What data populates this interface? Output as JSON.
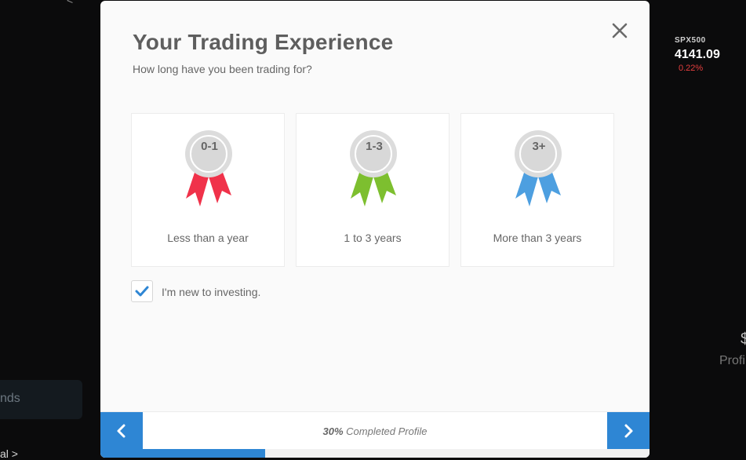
{
  "background": {
    "ticker": {
      "symbol": "SPX500",
      "price": "4141.09",
      "change": "0.22%"
    },
    "right_number": "$",
    "right_label": "Profi",
    "left_button": "nds",
    "left_link": "al >",
    "top_arrow": "<"
  },
  "modal": {
    "title": "Your Trading Experience",
    "subtitle": "How long have you been trading for?",
    "close_icon": "close-icon",
    "options": [
      {
        "badge": "0-1",
        "label": "Less than a year",
        "ribbon_color": "#f0324a"
      },
      {
        "badge": "1-3",
        "label": "1 to 3 years",
        "ribbon_color": "#7dbf2f"
      },
      {
        "badge": "3+",
        "label": "More than 3 years",
        "ribbon_color": "#4d9fe0"
      }
    ],
    "new_investor": {
      "label": "I'm new to investing.",
      "checked": true
    },
    "footer": {
      "progress_percent": "30%",
      "progress_suffix": " Completed Profile",
      "progress_fraction": 0.3,
      "prev_icon": "chevron-left-icon",
      "next_icon": "chevron-right-icon"
    }
  },
  "colors": {
    "accent": "#2e86d4",
    "title": "#5e5e5e"
  }
}
